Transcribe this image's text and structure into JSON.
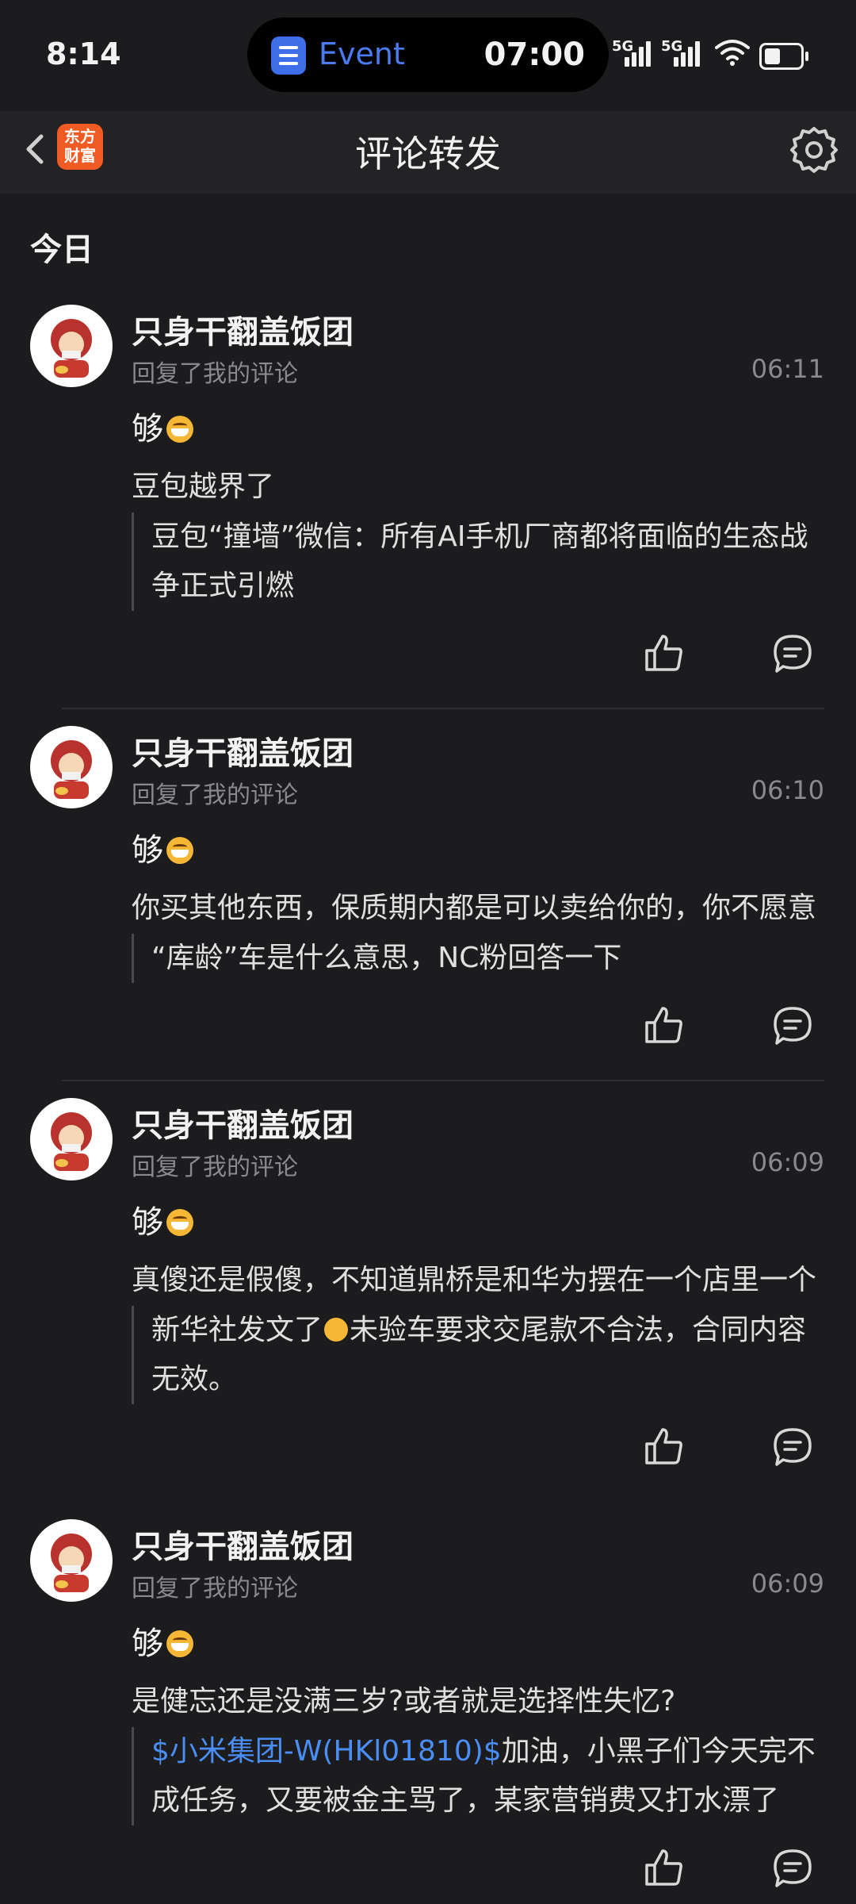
{
  "status_bar": {
    "time": "8:14",
    "event_label": "Event",
    "event_time": "07:00",
    "network1": "5G",
    "network2": "5G",
    "battery_level": 0.45
  },
  "nav": {
    "logo_text": "东方财富",
    "title": "评论转发"
  },
  "section_date": "今日",
  "accent_color": "#4a8ef5",
  "items": [
    {
      "username": "只身干翻盖饭团",
      "action": "回复了我的评论",
      "time": "06:11",
      "reply": "够",
      "my_comment": "豆包越界了",
      "quote_line1": "豆包“撞墙”微信：所有AI手机厂商都将面临的生态战",
      "quote_line2": "争正式引燃"
    },
    {
      "username": "只身干翻盖饭团",
      "action": "回复了我的评论",
      "time": "06:10",
      "reply": "够",
      "my_comment": "你买其他东西，保质期内都是可以卖给你的，你不愿意",
      "quote_line1": "“库龄”车是什么意思，NC粉回答一下"
    },
    {
      "username": "只身干翻盖饭团",
      "action": "回复了我的评论",
      "time": "06:09",
      "reply": "够",
      "my_comment": "真傻还是假傻，不知道鼎桥是和华为摆在一个店里一个",
      "quote_line1_a": "新华社发文了",
      "quote_line1_b": "未验车要求交尾款不合法，合同内容",
      "quote_line2": "无效。"
    },
    {
      "username": "只身干翻盖饭团",
      "action": "回复了我的评论",
      "time": "06:09",
      "reply": "够",
      "my_comment": "是健忘还是没满三岁?或者就是选择性失忆?",
      "quote_link": "$小米集团-W(HKl01810)$",
      "quote_line1_rest": "加油，小黑子们今天完不",
      "quote_line2": "成任务，又要被金主骂了，某家营销费又打水漂了"
    }
  ]
}
